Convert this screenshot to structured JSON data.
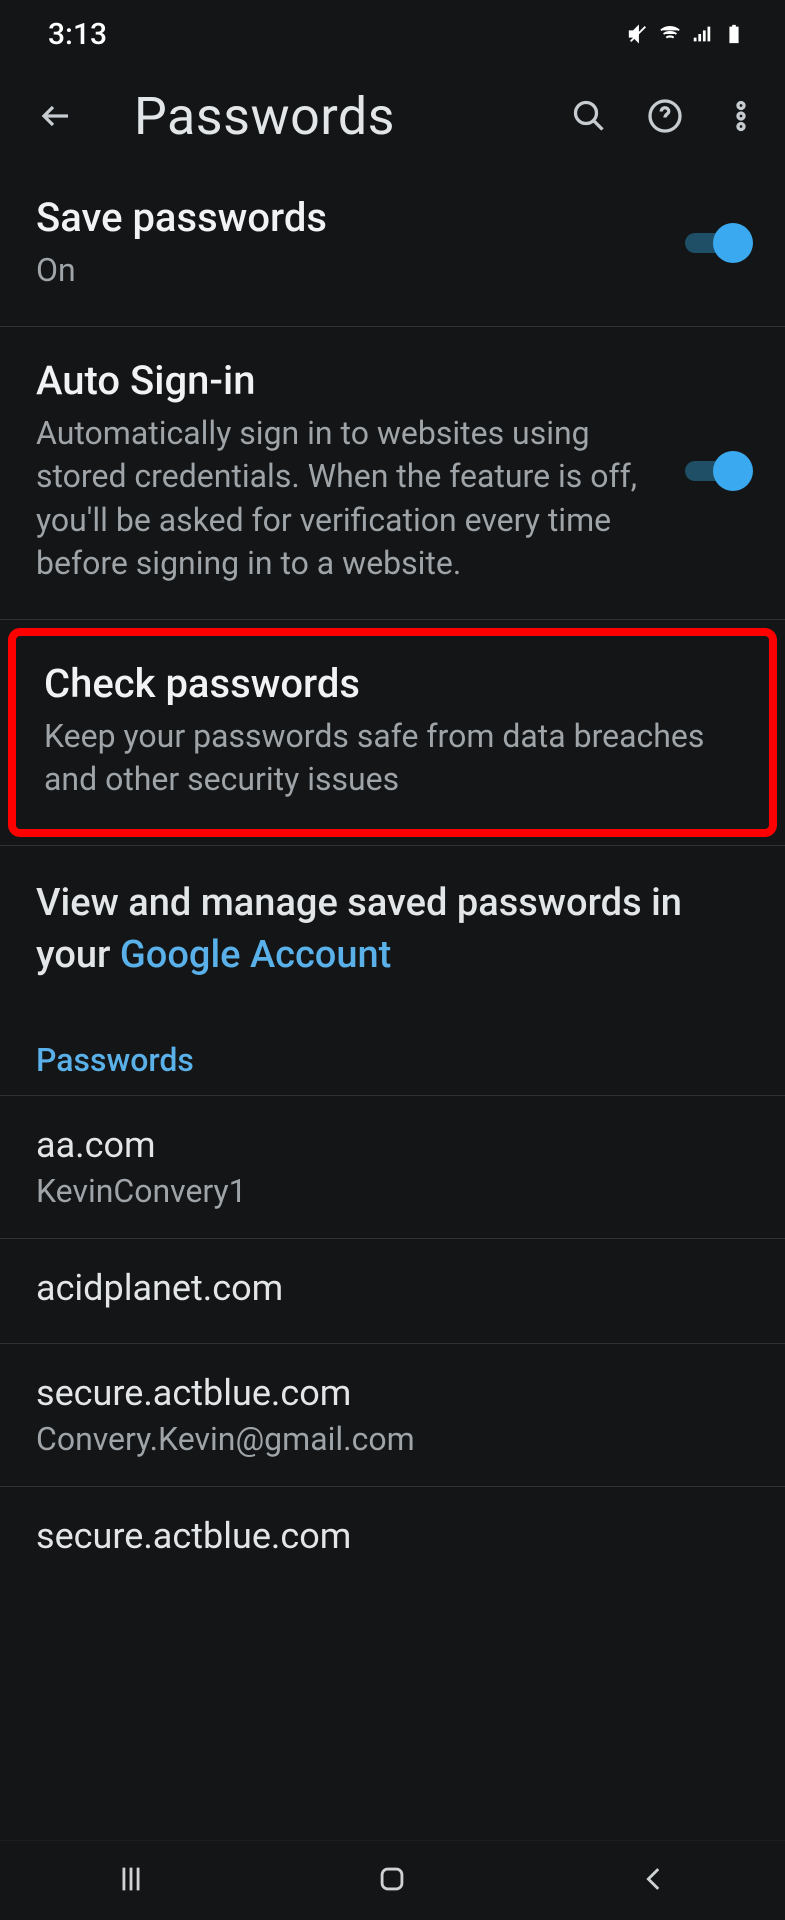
{
  "statusbar": {
    "time": "3:13"
  },
  "appbar": {
    "title": "Passwords"
  },
  "settings": {
    "save_passwords": {
      "title": "Save passwords",
      "status": "On",
      "enabled": true
    },
    "auto_signin": {
      "title": "Auto Sign-in",
      "desc": "Automatically sign in to websites using stored credentials. When the feature is off, you'll be asked for verification every time before signing in to a website.",
      "enabled": true
    },
    "check_passwords": {
      "title": "Check passwords",
      "desc": "Keep your passwords safe from data breaches and other security issues"
    },
    "manage": {
      "prefix": "View and manage saved passwords in your ",
      "link": "Google Account"
    }
  },
  "passwords_header": "Passwords",
  "passwords": [
    {
      "site": "aa.com",
      "user": "KevinConvery1"
    },
    {
      "site": "acidplanet.com",
      "user": ""
    },
    {
      "site": "secure.actblue.com",
      "user": "Convery.Kevin@gmail.com"
    },
    {
      "site": "secure.actblue.com",
      "user": ""
    }
  ]
}
